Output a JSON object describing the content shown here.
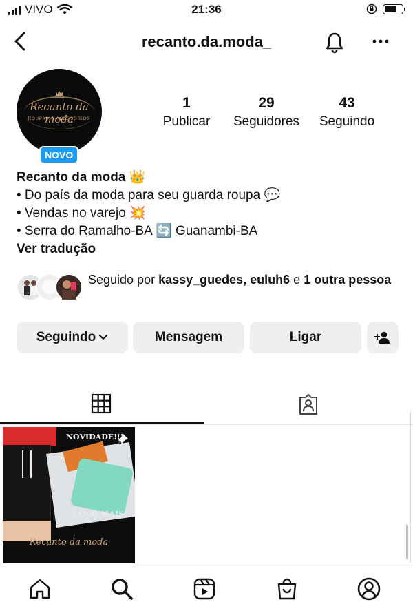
{
  "status_bar": {
    "carrier": "VIVO",
    "time": "21:36",
    "battery_level": 0.7
  },
  "header": {
    "username": "recanto.da.moda_"
  },
  "profile": {
    "avatar_brand": "Recanto da moda",
    "avatar_tagline": "ROUPAS E ACESSÓRIOS",
    "badge": "NOVO",
    "stats": [
      {
        "value": "1",
        "label": "Publicar"
      },
      {
        "value": "29",
        "label": "Seguidores"
      },
      {
        "value": "43",
        "label": "Seguindo"
      }
    ],
    "name": "Recanto da moda 👑",
    "bio_lines": [
      "• Do país da moda para seu guarda roupa 💬",
      "• Vendas no varejo 💥",
      "• Serra do Ramalho-BA 🔄 Guanambi-BA"
    ],
    "translate": "Ver tradução"
  },
  "followed_by": {
    "prefix": "Seguido por ",
    "users": "kassy_guedes, euluh6",
    "conj": " e ",
    "others": "1 outra pessoa"
  },
  "actions": {
    "following": "Seguindo",
    "message": "Mensagem",
    "call": "Ligar"
  },
  "tabs": {
    "active": "grid"
  },
  "post": {
    "top_text": "NOVIDADE!!!",
    "bottom_text": "LOGO MAIS",
    "brand": "Recanto da moda"
  },
  "colors": {
    "accent": "#1d9bf0",
    "button_bg": "#efefef"
  },
  "icons": [
    "back-icon",
    "bell-icon",
    "more-icon",
    "chevron-down-icon",
    "add-person-icon",
    "grid-icon",
    "tagged-icon",
    "pin-icon",
    "home-icon",
    "search-icon",
    "reels-icon",
    "shop-icon",
    "profile-icon"
  ]
}
